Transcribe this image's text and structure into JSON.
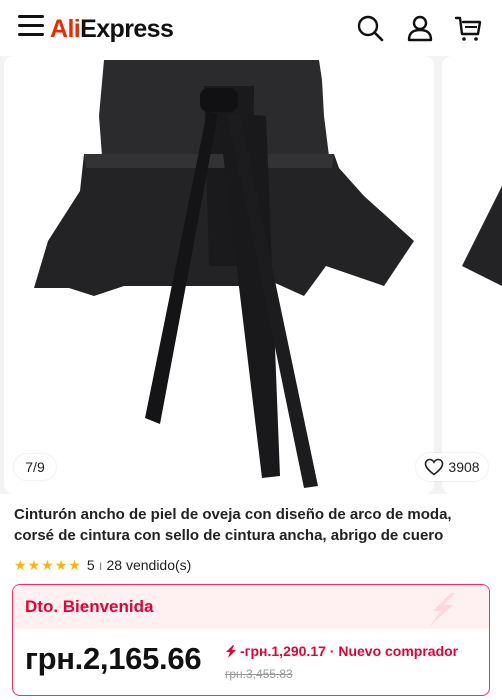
{
  "header": {
    "logo_ali": "Ali",
    "logo_express": "Express",
    "icons": [
      "menu-icon",
      "search-icon",
      "account-icon",
      "cart-icon"
    ]
  },
  "gallery": {
    "counter": "7/9",
    "wishlist_count": "3908"
  },
  "product": {
    "title": "Cinturón ancho de piel de oveja con diseño de arco de moda, corsé de cintura con sello de cintura ancha, abrigo de cuero",
    "rating": "5",
    "separator": "ı",
    "sold": "28 vendido(s)"
  },
  "price_card": {
    "label": "Dto. Bienvenida",
    "price": "грн.2,165.66",
    "discount": "-грн.1,290.17 · Nuevo comprador",
    "old_price": "грн.3,455.83"
  },
  "colors": {
    "accent": "#e6003a",
    "brand_red": "#e62e04",
    "brand_orange": "#ff7a00",
    "star": "#ffb400"
  }
}
